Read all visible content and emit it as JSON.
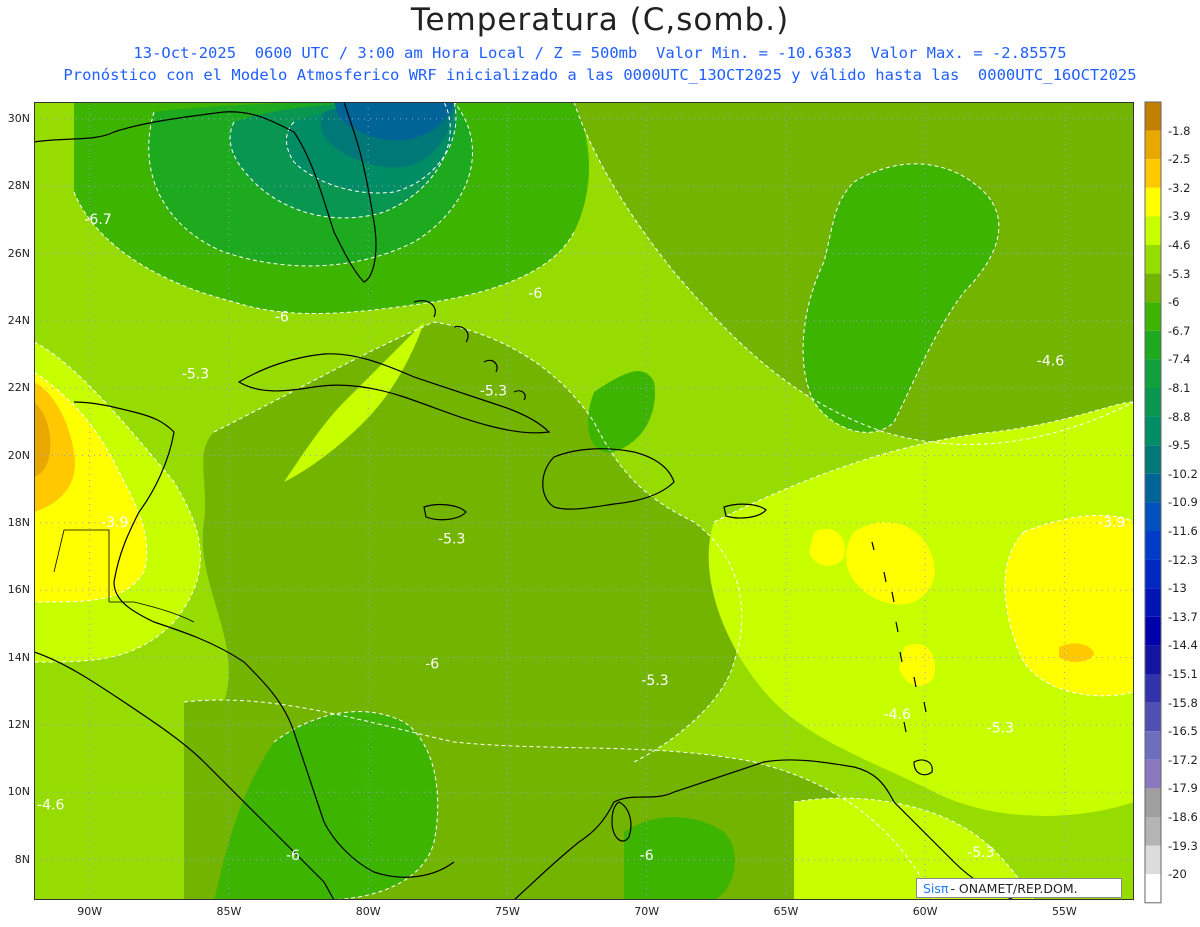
{
  "header": {
    "title": "Temperatura (C,somb.)",
    "subtitle_line1": "13-Oct-2025  0600 UTC / 3:00 am Hora Local / Z = 500mb  Valor Min. = -10.6383  Valor Max. = -2.85575",
    "subtitle_line2": "Pronóstico con el Modelo Atmosferico WRF inicializado a las 0000UTC_13OCT2025 y válido hasta las  0000UTC_16OCT2025"
  },
  "axes": {
    "x_ticks": [
      {
        "value": -90,
        "label": "90W"
      },
      {
        "value": -85,
        "label": "85W"
      },
      {
        "value": -80,
        "label": "80W"
      },
      {
        "value": -75,
        "label": "75W"
      },
      {
        "value": -70,
        "label": "70W"
      },
      {
        "value": -65,
        "label": "65W"
      },
      {
        "value": -60,
        "label": "60W"
      },
      {
        "value": -55,
        "label": "55W"
      }
    ],
    "y_ticks": [
      {
        "value": 30,
        "label": "30N"
      },
      {
        "value": 28,
        "label": "28N"
      },
      {
        "value": 26,
        "label": "26N"
      },
      {
        "value": 24,
        "label": "24N"
      },
      {
        "value": 22,
        "label": "22N"
      },
      {
        "value": 20,
        "label": "20N"
      },
      {
        "value": 18,
        "label": "18N"
      },
      {
        "value": 16,
        "label": "16N"
      },
      {
        "value": 14,
        "label": "14N"
      },
      {
        "value": 12,
        "label": "12N"
      },
      {
        "value": 10,
        "label": "10N"
      },
      {
        "value": 8,
        "label": "8N"
      }
    ],
    "lon_range": [
      -92,
      -52.5
    ],
    "lat_range": [
      6.8,
      30.5
    ]
  },
  "contour_labels": [
    {
      "text": "-6.7",
      "lon": -89.7,
      "lat": 27.0
    },
    {
      "text": "-6",
      "lon": -83.1,
      "lat": 24.1
    },
    {
      "text": "-5.3",
      "lon": -86.2,
      "lat": 22.4
    },
    {
      "text": "-6",
      "lon": -74.0,
      "lat": 24.8
    },
    {
      "text": "-5.3",
      "lon": -75.5,
      "lat": 21.9
    },
    {
      "text": "-3.9",
      "lon": -89.1,
      "lat": 18.0
    },
    {
      "text": "-5.3",
      "lon": -77.0,
      "lat": 17.5
    },
    {
      "text": "-6",
      "lon": -77.7,
      "lat": 13.8
    },
    {
      "text": "-5.3",
      "lon": -69.7,
      "lat": 13.3
    },
    {
      "text": "-4.6",
      "lon": -55.5,
      "lat": 22.8
    },
    {
      "text": "-3.9",
      "lon": -53.3,
      "lat": 18.0
    },
    {
      "text": "-4.6",
      "lon": -61.0,
      "lat": 12.3
    },
    {
      "text": "-5.3",
      "lon": -57.3,
      "lat": 11.9
    },
    {
      "text": "-4.6",
      "lon": -91.4,
      "lat": 9.6
    },
    {
      "text": "-6",
      "lon": -82.7,
      "lat": 8.1
    },
    {
      "text": "-6",
      "lon": -70.0,
      "lat": 8.1
    },
    {
      "text": "-5.3",
      "lon": -58.0,
      "lat": 8.2
    }
  ],
  "legend": {
    "levels": [
      {
        "label": "-1.8",
        "color": "#c18000"
      },
      {
        "label": "-2.5",
        "color": "#e8a800"
      },
      {
        "label": "-3.2",
        "color": "#ffc800"
      },
      {
        "label": "-3.9",
        "color": "#ffff00"
      },
      {
        "label": "-4.6",
        "color": "#c8ff00"
      },
      {
        "label": "-5.3",
        "color": "#96dc00"
      },
      {
        "label": "-6",
        "color": "#73b400"
      },
      {
        "label": "-6.7",
        "color": "#3cb400"
      },
      {
        "label": "-7.4",
        "color": "#1eaa1e"
      },
      {
        "label": "-8.1",
        "color": "#10a03c"
      },
      {
        "label": "-8.8",
        "color": "#089650"
      },
      {
        "label": "-9.5",
        "color": "#008c64"
      },
      {
        "label": "-10.2",
        "color": "#007878"
      },
      {
        "label": "-10.9",
        "color": "#006496"
      },
      {
        "label": "-11.6",
        "color": "#0050be"
      },
      {
        "label": "-12.3",
        "color": "#003cc8"
      },
      {
        "label": "-13",
        "color": "#0028c0"
      },
      {
        "label": "-13.7",
        "color": "#0014b4"
      },
      {
        "label": "-14.4",
        "color": "#0000aa"
      },
      {
        "label": "-15.1",
        "color": "#1414a0"
      },
      {
        "label": "-15.8",
        "color": "#3232aa"
      },
      {
        "label": "-16.5",
        "color": "#5050b4"
      },
      {
        "label": "-17.2",
        "color": "#6e6ebe"
      },
      {
        "label": "-17.9",
        "color": "#8c78be"
      },
      {
        "label": "-18.6",
        "color": "#a0a0a0"
      },
      {
        "label": "-19.3",
        "color": "#b4b4b4"
      },
      {
        "label": "-20",
        "color": "#dcdcdc"
      },
      {
        "label": "",
        "color": "#ffffff"
      }
    ]
  },
  "logo": {
    "brand": "Sisπ",
    "text": "- ONAMET/REP.DOM."
  },
  "colors": {
    "land_outline": "#000000",
    "contour_line": "#ffffff",
    "grid": "#9aa0c8"
  }
}
